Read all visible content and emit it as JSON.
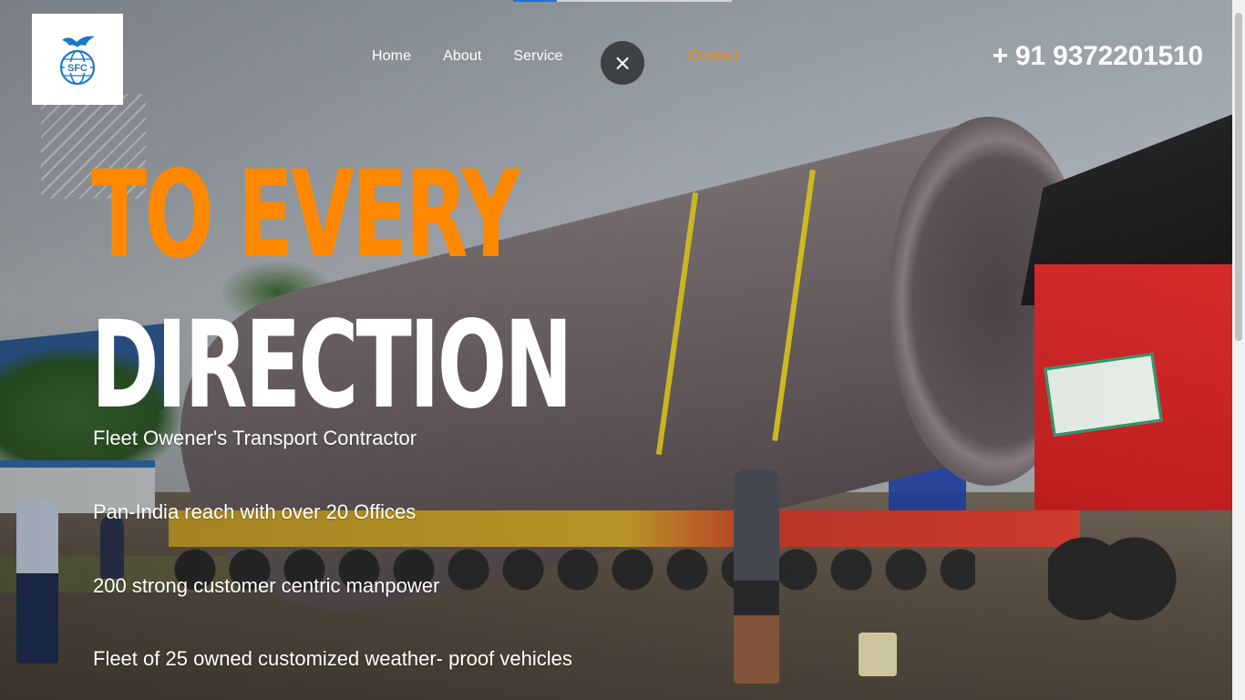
{
  "header": {
    "logo_text": "SFC",
    "phone": "+ 91 9372201510",
    "close_symbol": "×"
  },
  "nav": {
    "items": [
      {
        "label": "Home"
      },
      {
        "label": "About"
      },
      {
        "label": "Service"
      },
      {
        "label": "Contact",
        "active": true
      }
    ]
  },
  "hero": {
    "line1": "TO EVERY",
    "line2": "DIRECTION",
    "bullets": [
      "Fleet Owener's Transport Contractor",
      "Pan-India reach with over 20 Offices",
      "200 strong customer centric manpower",
      "Fleet of 25 owned customized weather- proof vehicles"
    ]
  },
  "colors": {
    "accent": "#ff8800",
    "text": "#ffffff",
    "close_button_bg": "#3d4144",
    "progress_fill": "#1e6fd9"
  },
  "icons": {
    "logo": "globe-eagle-logo",
    "close": "close-icon"
  },
  "slider_progress": 0.2
}
